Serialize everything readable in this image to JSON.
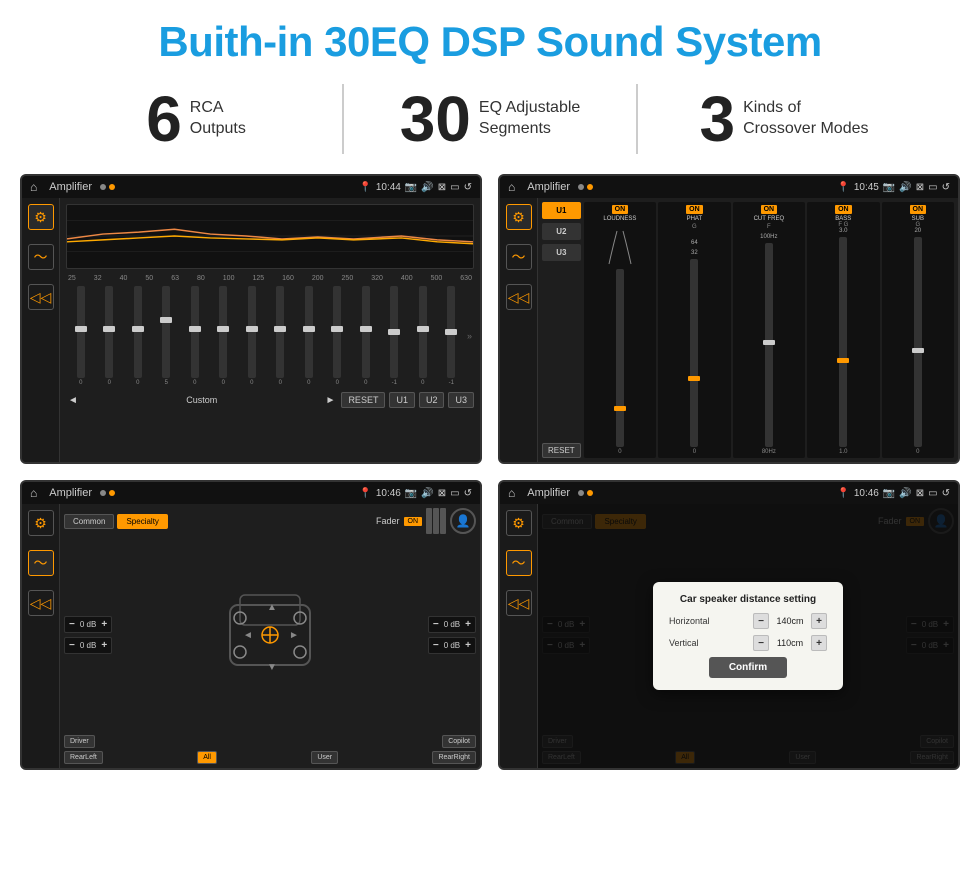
{
  "header": {
    "title": "Buith-in 30EQ DSP Sound System"
  },
  "stats": [
    {
      "number": "6",
      "line1": "RCA",
      "line2": "Outputs"
    },
    {
      "number": "30",
      "line1": "EQ Adjustable",
      "line2": "Segments"
    },
    {
      "number": "3",
      "line1": "Kinds of",
      "line2": "Crossover Modes"
    }
  ],
  "screens": [
    {
      "id": "eq-screen",
      "title": "Amplifier",
      "time": "10:44",
      "freqs": [
        "25",
        "32",
        "40",
        "50",
        "63",
        "80",
        "100",
        "125",
        "160",
        "200",
        "250",
        "320",
        "400",
        "500",
        "630"
      ],
      "vals": [
        "0",
        "0",
        "0",
        "5",
        "0",
        "0",
        "0",
        "0",
        "0",
        "0",
        "0",
        "-1",
        "0",
        "-1"
      ],
      "preset": "Custom",
      "buttons": [
        "RESET",
        "U1",
        "U2",
        "U3"
      ]
    },
    {
      "id": "crossover-screen",
      "title": "Amplifier",
      "time": "10:45",
      "presets": [
        "U1",
        "U2",
        "U3"
      ],
      "channels": [
        "LOUDNESS",
        "PHAT",
        "CUT FREQ",
        "BASS",
        "SUB"
      ]
    },
    {
      "id": "speaker-screen",
      "title": "Amplifier",
      "time": "10:46",
      "tabs": [
        "Common",
        "Specialty"
      ],
      "fader_label": "Fader",
      "fader_on": "ON",
      "volumes": [
        "0 dB",
        "0 dB",
        "0 dB",
        "0 dB"
      ],
      "buttons": [
        "Driver",
        "Copilot",
        "RearLeft",
        "All",
        "User",
        "RearRight"
      ]
    },
    {
      "id": "dialog-screen",
      "title": "Amplifier",
      "time": "10:46",
      "tabs": [
        "Common",
        "Specialty"
      ],
      "dialog": {
        "title": "Car speaker distance setting",
        "horizontal_label": "Horizontal",
        "horizontal_value": "140cm",
        "vertical_label": "Vertical",
        "vertical_value": "110cm",
        "confirm_label": "Confirm"
      },
      "buttons": [
        "Driver",
        "Copilot",
        "RearLeft",
        "All",
        "User",
        "RearRight"
      ]
    }
  ]
}
